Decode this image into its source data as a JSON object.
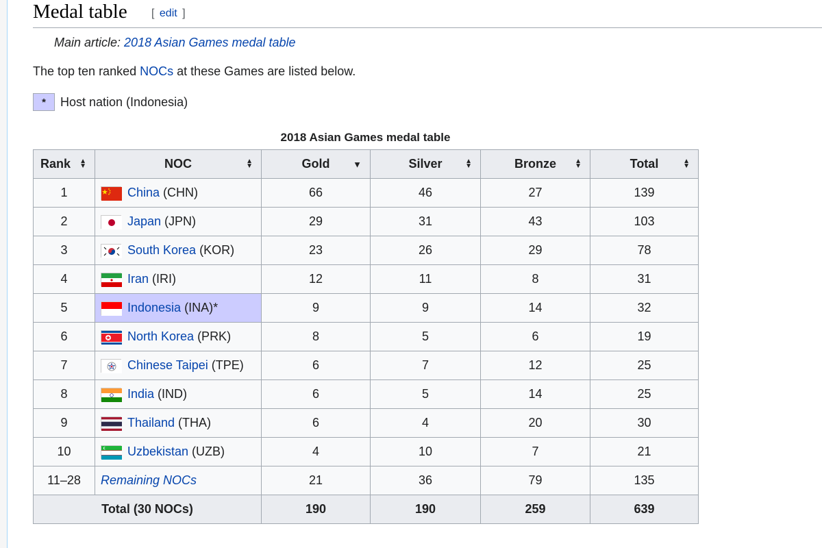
{
  "heading": {
    "title": "Medal table",
    "edit_open": "[",
    "edit_label": "edit",
    "edit_close": "]"
  },
  "hatnote": {
    "prefix": "Main article: ",
    "link": "2018 Asian Games medal table"
  },
  "intro": {
    "before": "The top ten ranked ",
    "link": "NOCs",
    "after": " at these Games are listed below."
  },
  "legend": {
    "symbol": "*",
    "text": "Host nation (Indonesia)"
  },
  "table": {
    "caption": "2018 Asian Games medal table",
    "headers": {
      "rank": "Rank",
      "noc": "NOC",
      "gold": "Gold",
      "silver": "Silver",
      "bronze": "Bronze",
      "total": "Total"
    },
    "colors": {
      "gold": "#ffd700",
      "silver": "#c0c0c0",
      "bronze": "#cc9966",
      "host": "#ccccff"
    },
    "rows": [
      {
        "rank": "1",
        "name": "China",
        "code": "(CHN)",
        "flag": "china-flag-icon",
        "gold": "66",
        "silver": "46",
        "bronze": "27",
        "total": "139"
      },
      {
        "rank": "2",
        "name": "Japan",
        "code": "(JPN)",
        "flag": "japan-flag-icon",
        "gold": "29",
        "silver": "31",
        "bronze": "43",
        "total": "103"
      },
      {
        "rank": "3",
        "name": "South Korea",
        "code": "(KOR)",
        "flag": "south-korea-flag-icon",
        "gold": "23",
        "silver": "26",
        "bronze": "29",
        "total": "78"
      },
      {
        "rank": "4",
        "name": "Iran",
        "code": "(IRI)",
        "flag": "iran-flag-icon",
        "gold": "12",
        "silver": "11",
        "bronze": "8",
        "total": "31"
      },
      {
        "rank": "5",
        "name": "Indonesia",
        "code": "(INA)*",
        "flag": "indonesia-flag-icon",
        "gold": "9",
        "silver": "9",
        "bronze": "14",
        "total": "32",
        "host": true
      },
      {
        "rank": "6",
        "name": "North Korea",
        "code": "(PRK)",
        "flag": "north-korea-flag-icon",
        "gold": "8",
        "silver": "5",
        "bronze": "6",
        "total": "19"
      },
      {
        "rank": "7",
        "name": "Chinese Taipei",
        "code": "(TPE)",
        "flag": "chinese-taipei-flag-icon",
        "gold": "6",
        "silver": "7",
        "bronze": "12",
        "total": "25"
      },
      {
        "rank": "8",
        "name": "India",
        "code": "(IND)",
        "flag": "india-flag-icon",
        "gold": "6",
        "silver": "5",
        "bronze": "14",
        "total": "25"
      },
      {
        "rank": "9",
        "name": "Thailand",
        "code": "(THA)",
        "flag": "thailand-flag-icon",
        "gold": "6",
        "silver": "4",
        "bronze": "20",
        "total": "30"
      },
      {
        "rank": "10",
        "name": "Uzbekistan",
        "code": "(UZB)",
        "flag": "uzbekistan-flag-icon",
        "gold": "4",
        "silver": "10",
        "bronze": "7",
        "total": "21"
      }
    ],
    "remaining": {
      "rank": "11–28",
      "name": "Remaining NOCs",
      "gold": "21",
      "silver": "36",
      "bronze": "79",
      "total": "135"
    },
    "totals": {
      "label": "Total (30 NOCs)",
      "gold": "190",
      "silver": "190",
      "bronze": "259",
      "total": "639"
    }
  }
}
